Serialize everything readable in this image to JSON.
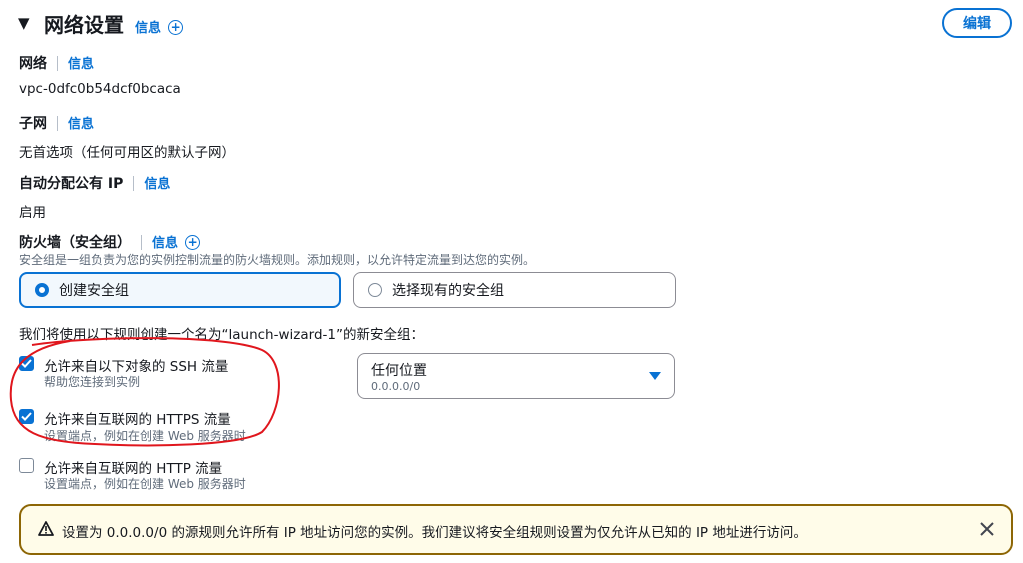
{
  "header": {
    "title": "网络设置",
    "info_label": "信息",
    "edit_label": "编辑"
  },
  "network": {
    "label": "网络",
    "info_label": "信息",
    "value": "vpc-0dfc0b54dcf0bcaca"
  },
  "subnet": {
    "label": "子网",
    "info_label": "信息",
    "value": "无首选项（任何可用区的默认子网）"
  },
  "public_ip": {
    "label": "自动分配公有 IP",
    "info_label": "信息",
    "value": "启用"
  },
  "firewall": {
    "label": "防火墙（安全组）",
    "info_label": "信息",
    "description": "安全组是一组负责为您的实例控制流量的防火墙规则。添加规则，以允许特定流量到达您的实例。",
    "options": [
      {
        "label": "创建安全组",
        "selected": true
      },
      {
        "label": "选择现有的安全组",
        "selected": false
      }
    ],
    "rules_intro": "我们将使用以下规则创建一个名为“launch-wizard-1”的新安全组："
  },
  "rules": [
    {
      "label": "允许来自以下对象的 SSH 流量",
      "description": "帮助您连接到实例",
      "checked": true
    },
    {
      "label": "允许来自互联网的 HTTPS 流量",
      "description": "设置端点，例如在创建 Web 服务器时",
      "checked": true
    },
    {
      "label": "允许来自互联网的 HTTP 流量",
      "description": "设置端点，例如在创建 Web 服务器时",
      "checked": false
    }
  ],
  "source_select": {
    "value": "任何位置",
    "sub_value": "0.0.0.0/0"
  },
  "warning": {
    "text": "设置为 0.0.0.0/0 的源规则允许所有 IP 地址访问您的实例。我们建议将安全组规则设置为仅允许从已知的 IP 地址进行访问。"
  },
  "colors": {
    "link": "#0972d3",
    "warning_border": "#8d6605",
    "annotation": "#e0161d"
  }
}
